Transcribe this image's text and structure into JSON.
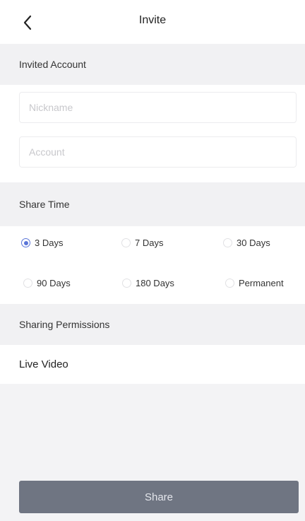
{
  "header": {
    "title": "Invite"
  },
  "invited_account": {
    "section_label": "Invited Account",
    "nickname": {
      "placeholder": "Nickname",
      "value": ""
    },
    "account": {
      "placeholder": "Account",
      "value": ""
    }
  },
  "share_time": {
    "section_label": "Share Time",
    "selected": "3 Days",
    "options": [
      "3 Days",
      "7 Days",
      "30 Days",
      "90 Days",
      "180 Days",
      "Permanent"
    ]
  },
  "sharing_permissions": {
    "section_label": "Sharing Permissions",
    "items": [
      "Live Video"
    ]
  },
  "footer": {
    "share_label": "Share"
  },
  "colors": {
    "accent": "#5a75d8",
    "button_bg": "#6f7582",
    "section_bg": "#f1f1f3"
  },
  "icons": {
    "back": "chevron-left-icon"
  }
}
